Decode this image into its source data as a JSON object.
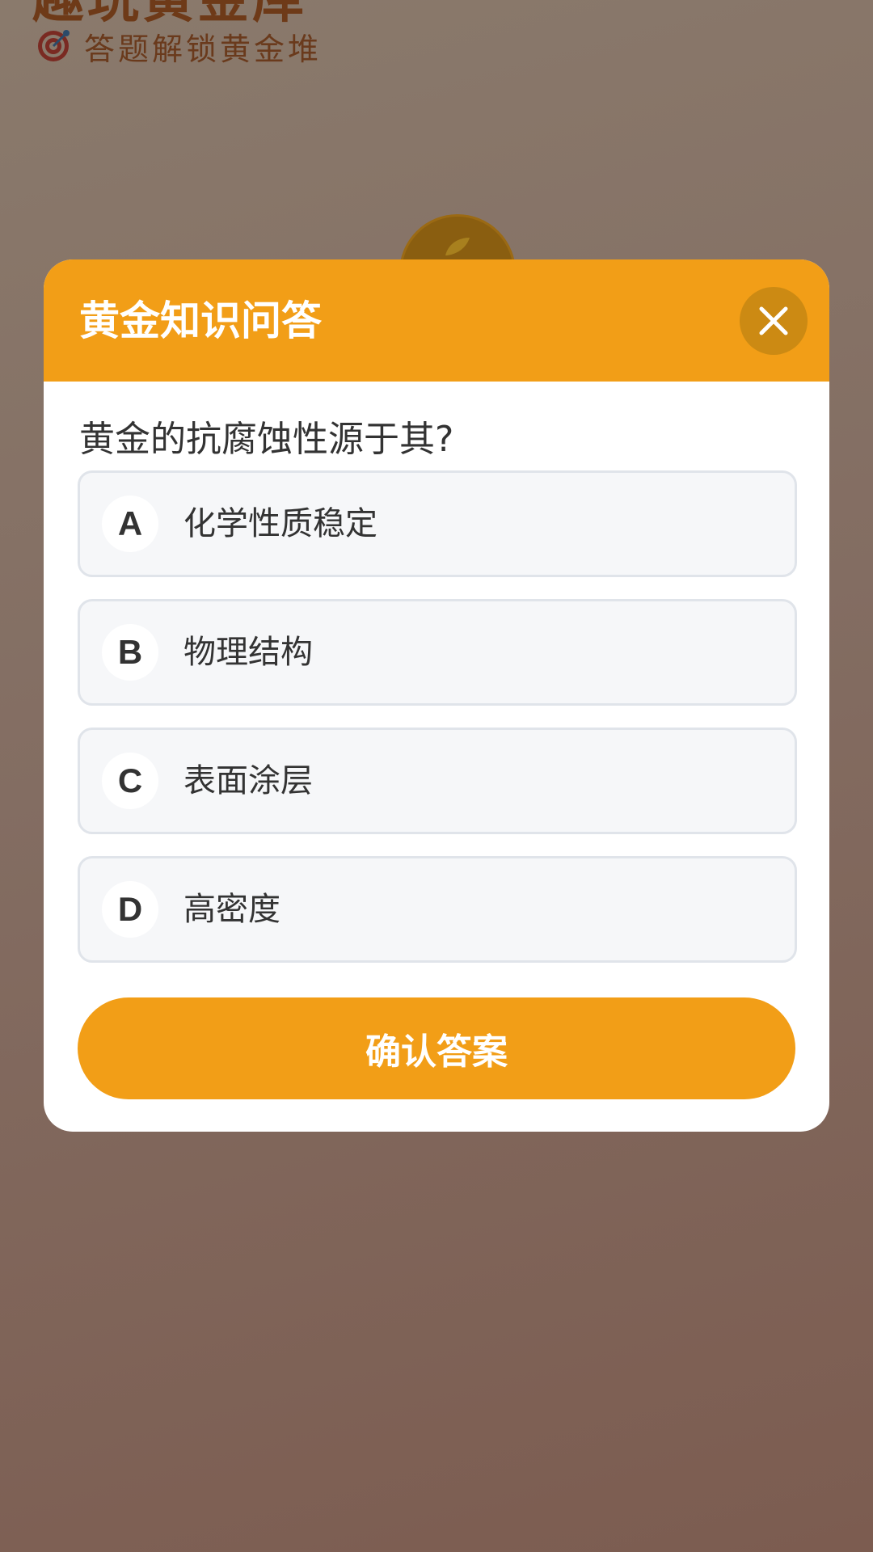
{
  "background": {
    "title": "趣玩黄金库",
    "subtitle": "答题解锁黄金堆",
    "subtitle_icon": "target-icon",
    "coin_icon": "gold-coin-icon"
  },
  "modal": {
    "title": "黄金知识问答",
    "close_icon": "close-icon",
    "question": "黄金的抗腐蚀性源于其?",
    "options": [
      {
        "letter": "A",
        "text": "化学性质稳定"
      },
      {
        "letter": "B",
        "text": "物理结构"
      },
      {
        "letter": "C",
        "text": "表面涂层"
      },
      {
        "letter": "D",
        "text": "高密度"
      }
    ],
    "confirm_label": "确认答案"
  },
  "colors": {
    "accent": "#f29e17",
    "close_button_bg": "#cc8a13",
    "option_bg": "#f6f7f9",
    "option_border": "#e0e4ea",
    "text": "#333333"
  }
}
